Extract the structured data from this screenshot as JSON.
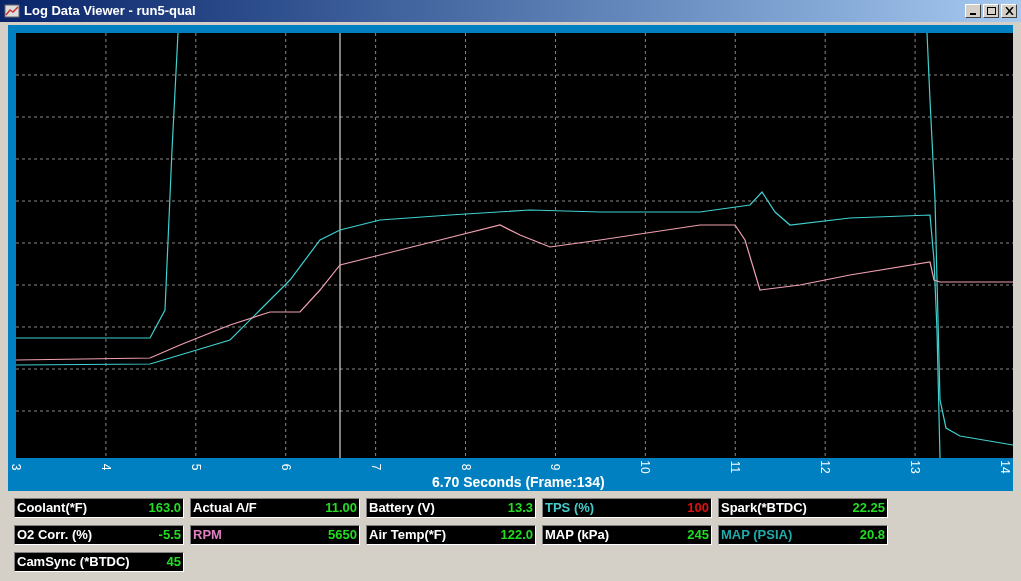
{
  "window": {
    "title": "Log Data Viewer - run5-qual"
  },
  "chart": {
    "x_ticks": [
      "3",
      "4",
      "5",
      "6",
      "7",
      "8",
      "9",
      "10",
      "11",
      "12",
      "13",
      "14"
    ],
    "cursor_caption": "6.70 Seconds (Frame:134)"
  },
  "gauges": [
    {
      "label": "Coolant(*F)",
      "value": "163.0",
      "kind": "plain",
      "alarm": false
    },
    {
      "label": "Actual A/F",
      "value": "11.00",
      "kind": "plain",
      "alarm": false
    },
    {
      "label": "Battery (V)",
      "value": "13.3",
      "kind": "plain",
      "alarm": false
    },
    {
      "label": "TPS (%)",
      "value": "100",
      "kind": "cyan",
      "alarm": true
    },
    {
      "label": "Spark(*BTDC)",
      "value": "22.25",
      "kind": "plain",
      "alarm": false
    },
    {
      "label": "O2 Corr. (%)",
      "value": "-5.5",
      "kind": "plain",
      "alarm": false
    },
    {
      "label": "RPM",
      "value": "5650",
      "kind": "pink",
      "alarm": false
    },
    {
      "label": "Air Temp(*F)",
      "value": "122.0",
      "kind": "plain",
      "alarm": false
    },
    {
      "label": "MAP (kPa)",
      "value": "245",
      "kind": "plain",
      "alarm": false
    },
    {
      "label": "MAP (PSIA)",
      "value": "20.8",
      "kind": "teal",
      "alarm": false
    },
    {
      "label": "CamSync (*BTDC)",
      "value": "45",
      "kind": "plain",
      "alarm": false
    }
  ]
}
